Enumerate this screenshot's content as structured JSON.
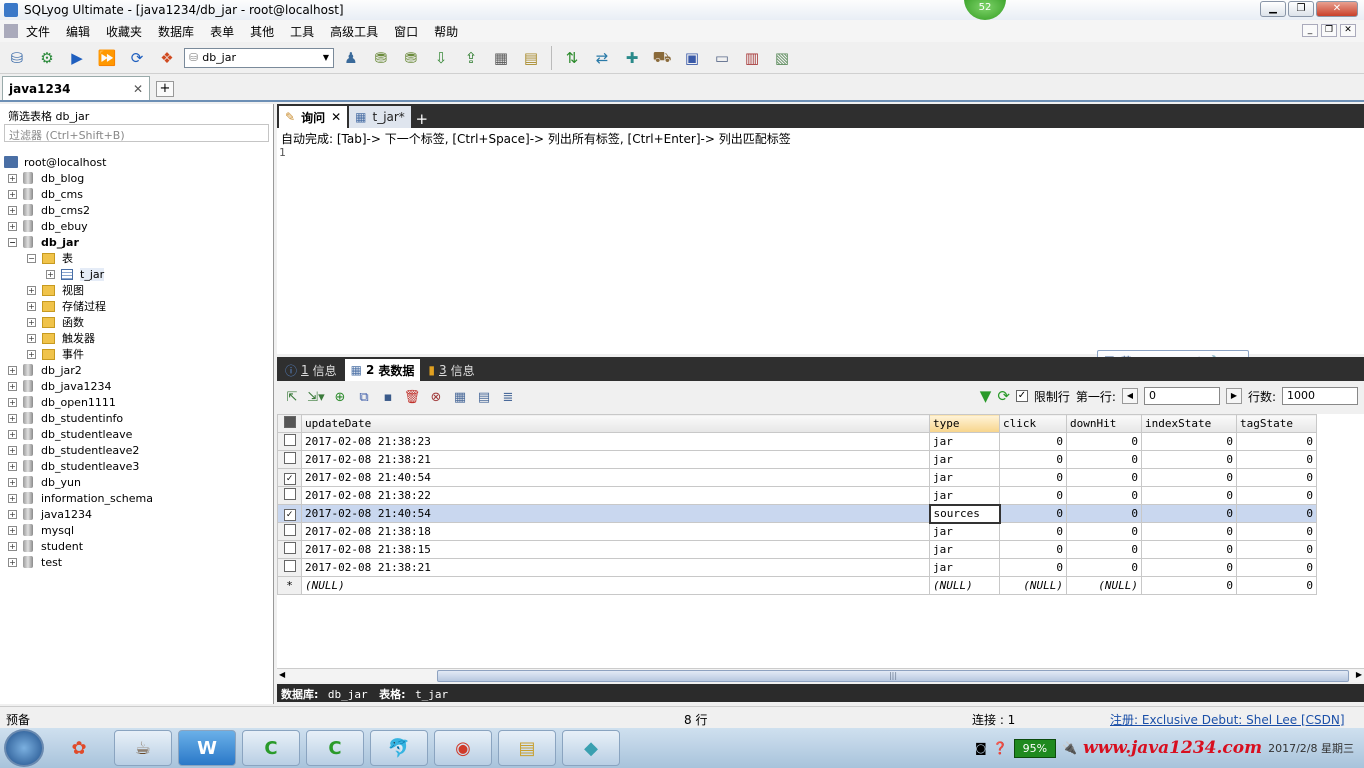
{
  "window": {
    "title": "SQLyog Ultimate - [java1234/db_jar - root@localhost]",
    "badge": "52"
  },
  "menu": [
    "文件",
    "编辑",
    "收藏夹",
    "数据库",
    "表单",
    "其他",
    "工具",
    "高级工具",
    "窗口",
    "帮助"
  ],
  "toolbar": {
    "db_selected": "db_jar"
  },
  "connection_tab": {
    "label": "java1234"
  },
  "left": {
    "filter_title": "筛选表格 db_jar",
    "filter_placeholder": "过滤器 (Ctrl+Shift+B)",
    "server": "root@localhost",
    "databases_top": [
      "db_blog",
      "db_cms",
      "db_cms2",
      "db_ebuy"
    ],
    "current_db": "db_jar",
    "table_folder": "表",
    "table": "t_jar",
    "folders": [
      "视图",
      "存储过程",
      "函数",
      "触发器",
      "事件"
    ],
    "databases_bottom": [
      "db_jar2",
      "db_java1234",
      "db_open1111",
      "db_studentinfo",
      "db_studentleave",
      "db_studentleave2",
      "db_studentleave3",
      "db_yun",
      "information_schema",
      "java1234",
      "mysql",
      "student",
      "test"
    ]
  },
  "query_tabs": [
    {
      "label": "询问"
    },
    {
      "label": "t_jar*"
    }
  ],
  "editor": {
    "hint": "自动完成: [Tab]-> 下一个标签, [Ctrl+Space]-> 列出所有标签, [Ctrl+Enter]-> 列出匹配标签",
    "line": "1"
  },
  "ime": {
    "lang": "英"
  },
  "result_tabs": [
    {
      "num": "1",
      "label": "信息"
    },
    {
      "num": "2",
      "label": "表数据"
    },
    {
      "num": "3",
      "label": "信息"
    }
  ],
  "result_tools": {
    "limit_label": "限制行",
    "first_row_label": "第一行:",
    "first_row_value": "0",
    "rows_label": "行数:",
    "rows_value": "1000"
  },
  "grid": {
    "columns": [
      "updateDate",
      "type",
      "click",
      "downHit",
      "indexState",
      "tagState"
    ],
    "rows": [
      {
        "checked": false,
        "cells": [
          "2017-02-08 21:38:23",
          "jar",
          "0",
          "0",
          "0",
          "0"
        ]
      },
      {
        "checked": false,
        "cells": [
          "2017-02-08 21:38:21",
          "jar",
          "0",
          "0",
          "0",
          "0"
        ]
      },
      {
        "checked": true,
        "cells": [
          "2017-02-08 21:40:54",
          "jar",
          "0",
          "0",
          "0",
          "0"
        ]
      },
      {
        "checked": false,
        "cells": [
          "2017-02-08 21:38:22",
          "jar",
          "0",
          "0",
          "0",
          "0"
        ]
      },
      {
        "checked": true,
        "cells": [
          "2017-02-08 21:40:54",
          "sources",
          "0",
          "0",
          "0",
          "0"
        ]
      },
      {
        "checked": false,
        "cells": [
          "2017-02-08 21:38:18",
          "jar",
          "0",
          "0",
          "0",
          "0"
        ]
      },
      {
        "checked": false,
        "cells": [
          "2017-02-08 21:38:15",
          "jar",
          "0",
          "0",
          "0",
          "0"
        ]
      },
      {
        "checked": false,
        "cells": [
          "2017-02-08 21:38:21",
          "jar",
          "0",
          "0",
          "0",
          "0"
        ]
      }
    ],
    "new_row": [
      "(NULL)",
      "(NULL)",
      "(NULL)",
      "(NULL)",
      "0",
      "0"
    ],
    "new_row_marker": "*"
  },
  "infobar": {
    "db_label": "数据库:",
    "db": "db_jar",
    "table_label": "表格:",
    "table": "t_jar"
  },
  "status": {
    "ready": "预备",
    "rows": "8 行",
    "conn": "连接 : 1",
    "reg": "注册:  Exclusive Debut: Shel Lee [CSDN]"
  },
  "taskbar": {
    "battery": "95%",
    "watermark": "www.java1234.com",
    "date": "2017/2/8 星期三"
  }
}
